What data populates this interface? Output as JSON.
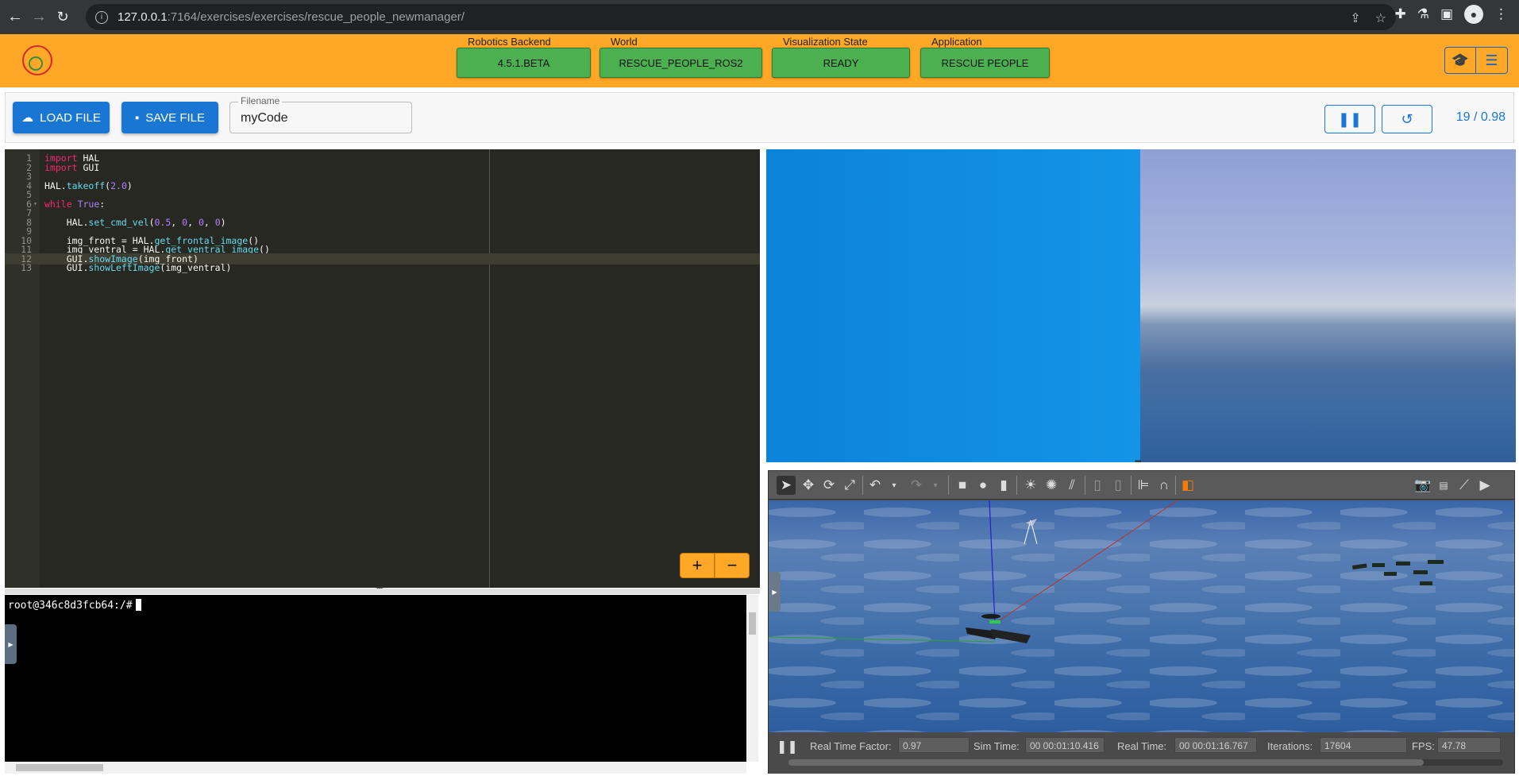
{
  "browser": {
    "url_host": "127.0.0.1",
    "url_path": ":7164/exercises/exercises/rescue_people_newmanager/"
  },
  "header": {
    "statuses": [
      {
        "label": "Robotics Backend",
        "value": "4.5.1.BETA"
      },
      {
        "label": "World",
        "value": "RESCUE_PEOPLE_ROS2"
      },
      {
        "label": "Visualization State",
        "value": "READY"
      },
      {
        "label": "Application",
        "value": "RESCUE PEOPLE"
      }
    ]
  },
  "toolbar": {
    "load_label": "LOAD FILE",
    "save_label": "SAVE FILE",
    "filename_label": "Filename",
    "filename_value": "myCode",
    "counter": "19 / 0.98"
  },
  "editor": {
    "lines": [
      {
        "n": "1",
        "code": "import HAL"
      },
      {
        "n": "2",
        "code": "import GUI"
      },
      {
        "n": "3",
        "code": ""
      },
      {
        "n": "4",
        "code": "HAL.takeoff(2.0)"
      },
      {
        "n": "5",
        "code": ""
      },
      {
        "n": "6",
        "code": "while True:"
      },
      {
        "n": "7",
        "code": ""
      },
      {
        "n": "8",
        "code": "    HAL.set_cmd_vel(0.5, 0, 0, 0)"
      },
      {
        "n": "9",
        "code": ""
      },
      {
        "n": "10",
        "code": "    img_front = HAL.get_frontal_image()"
      },
      {
        "n": "11",
        "code": "    img_ventral = HAL.get_ventral_image()"
      },
      {
        "n": "12",
        "code": "    GUI.showImage(img_front)"
      },
      {
        "n": "13",
        "code": "    GUI.showLeftImage(img_ventral)"
      }
    ],
    "zoom_in": "+",
    "zoom_out": "−"
  },
  "terminal": {
    "prompt": "root@346c8d3fcb64:/#"
  },
  "gazebo": {
    "rtf_label": "Real Time Factor:",
    "rtf_value": "0.97",
    "sim_label": "Sim Time:",
    "sim_value": "00 00:01:10.416",
    "real_label": "Real Time:",
    "real_value": "00 00:01:16.767",
    "iter_label": "Iterations:",
    "iter_value": "17604",
    "fps_label": "FPS:",
    "fps_value": "47.78"
  }
}
